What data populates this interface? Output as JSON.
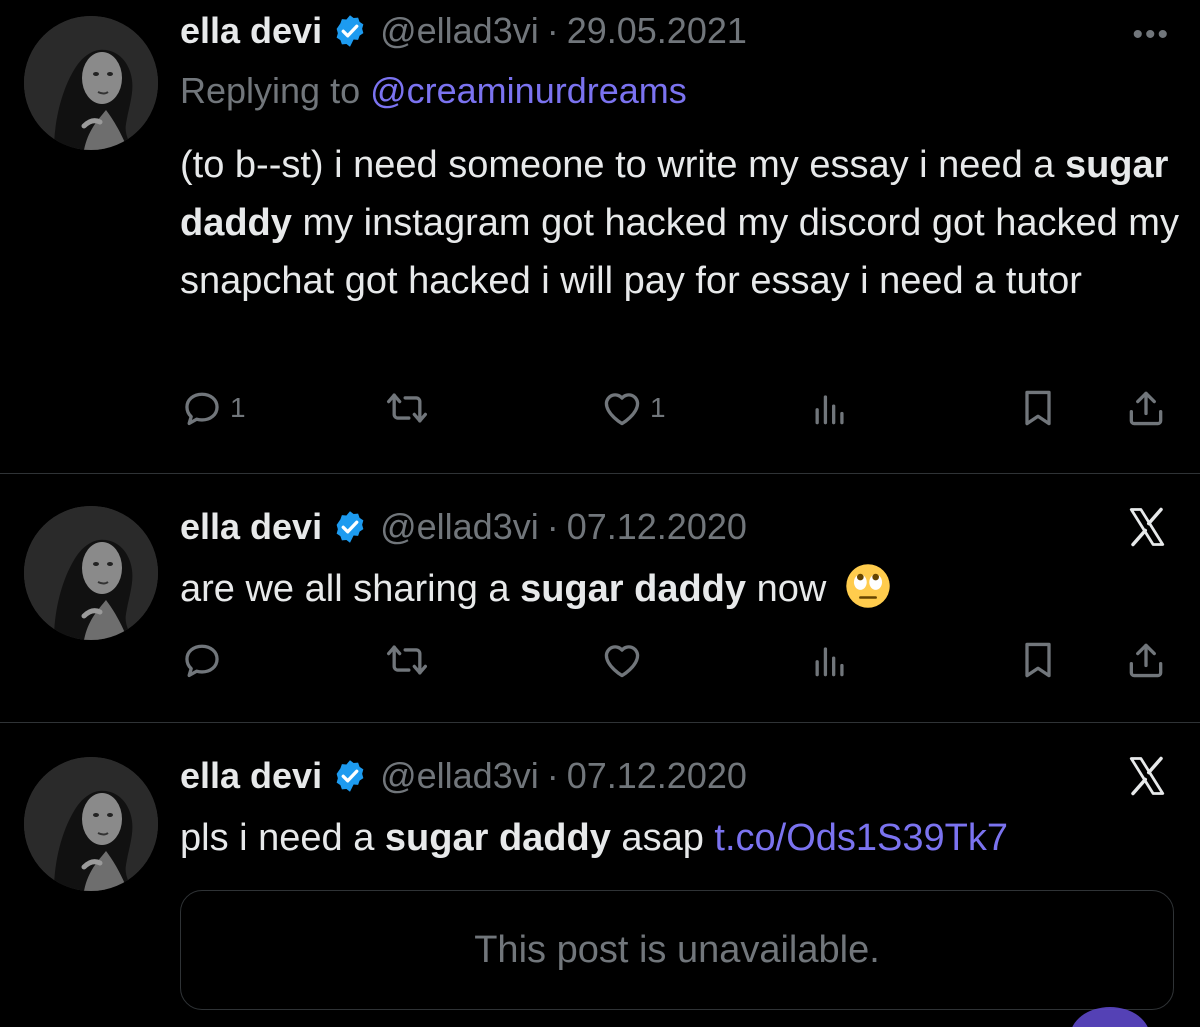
{
  "colors": {
    "background": "#000000",
    "text": "#e7e9ea",
    "muted": "#71767b",
    "link": "#7b73f0",
    "verified": "#1d9bf0",
    "divider": "#2f3336"
  },
  "posts": [
    {
      "author": "ella devi",
      "handle": "@ellad3vi",
      "separator": "·",
      "date": "29.05.2021",
      "menu_icon": "more-icon",
      "replying_prefix": "Replying to ",
      "replying_to": "@creaminurdreams",
      "text_before": "(to b--st) i need someone to write my essay i need a ",
      "text_bold": "sugar daddy",
      "text_after": " my instagram got hacked my discord got hacked my snapchat got hacked i will pay for essay i need a tutor",
      "reply_count": "1",
      "like_count": "1"
    },
    {
      "author": "ella devi",
      "handle": "@ellad3vi",
      "separator": "·",
      "date": "07.12.2020",
      "menu_icon": "x-logo-icon",
      "text_before": "are we all sharing a ",
      "text_bold": "sugar daddy",
      "text_after": " now",
      "emoji": "face-with-rolling-eyes-emoji"
    },
    {
      "author": "ella devi",
      "handle": "@ellad3vi",
      "separator": "·",
      "date": "07.12.2020",
      "menu_icon": "x-logo-icon",
      "text_before": "pls i need a ",
      "text_bold": "sugar daddy",
      "text_after": " asap ",
      "link": "t.co/Ods1S39Tk7",
      "quoted_unavailable": "This post is unavailable."
    }
  ],
  "action_icons": [
    "reply-icon",
    "repost-icon",
    "like-icon",
    "views-icon",
    "bookmark-icon",
    "share-icon"
  ]
}
